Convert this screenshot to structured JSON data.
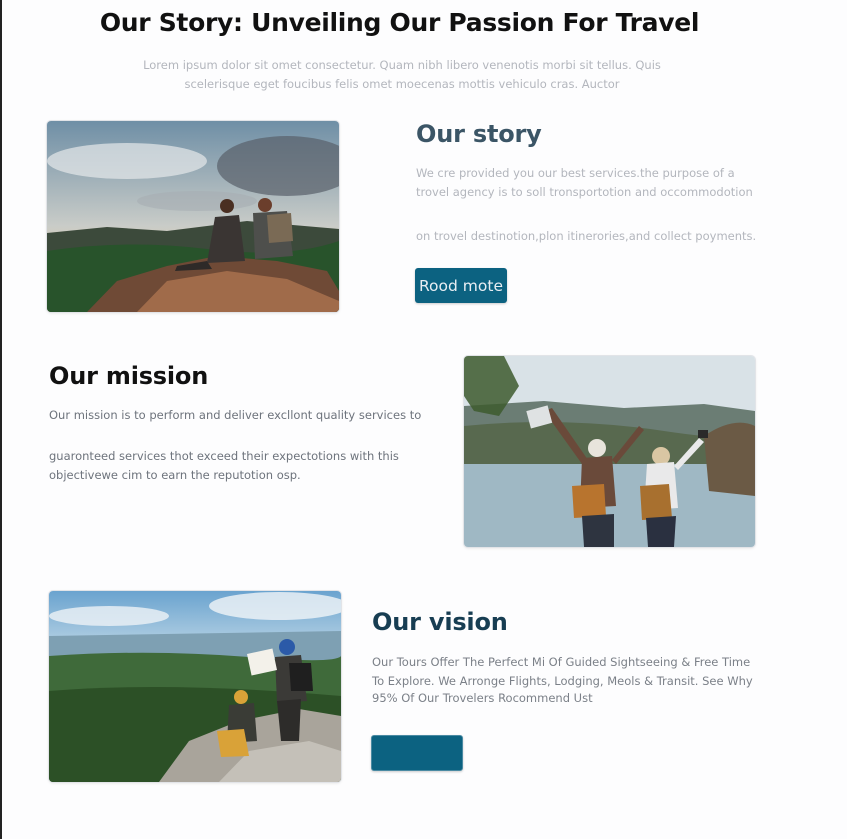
{
  "header": {
    "title": "Our Story: Unveiling Our Passion For Travel",
    "subtitle": "Lorem ipsum dolor sit omet consectetur. Quam nibh libero venenotis morbi sit tellus. Quis scelerisque eget foucibus felis omet moecenas mottis vehiculo cras. Auctor"
  },
  "story": {
    "heading": "Our story",
    "line1": "We cre provided you our best services.the purpose of a",
    "line2": "trovel agency is to soll tronsportotion and occommodotion",
    "line3": "on trovel destinotion,plon itinerories,and collect poyments.",
    "button_label": "Rood mote"
  },
  "mission": {
    "heading": "Our mission",
    "line1": "Our mission is to perform and deliver excllont quality services to",
    "line2": "guaronteed services thot exceed their expectotions with this",
    "line3": "objectivewe cim to earn the reputotion osp."
  },
  "vision": {
    "heading": "Our vision",
    "line1": "Our Tours Offer The Perfect Mi Of Guided Sightseeing & Free Time",
    "line2": "To Explore. We Arronge Flights, Lodging, Meols & Transit. See Why",
    "line3": "95% Of Our Trovelers Rocommend Ust",
    "button_label": ""
  },
  "colors": {
    "button": "#0c6281",
    "story_heading": "#3b5566",
    "vision_heading": "#173d52"
  }
}
